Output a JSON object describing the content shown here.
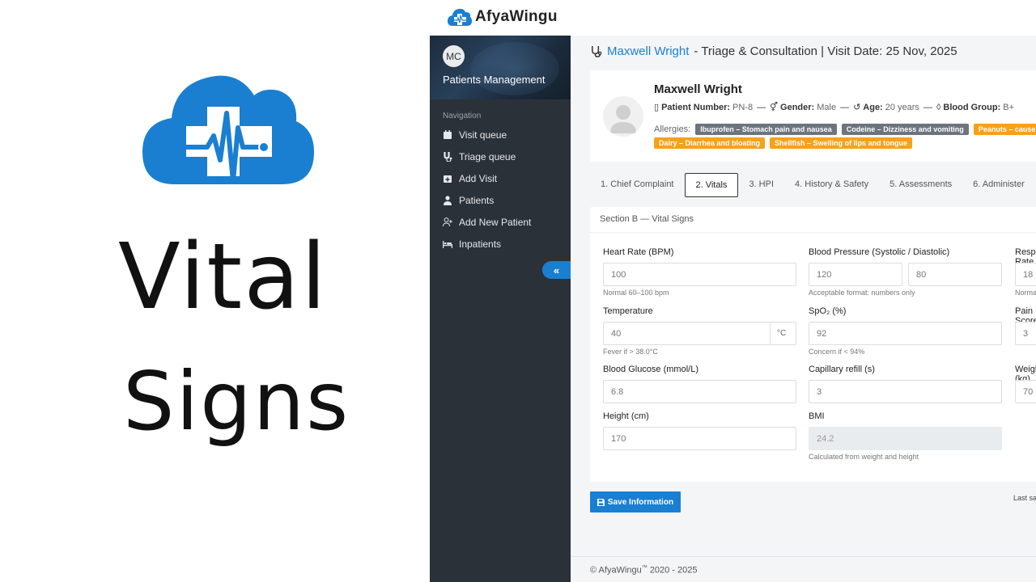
{
  "promo": {
    "title_line1": "Vital",
    "title_line2": "Signs",
    "brand_color": "#1a7fd1"
  },
  "topbar": {
    "brand_name": "AfyaWingu"
  },
  "sidebar": {
    "avatar_initials": "MC",
    "title": "Patients Management",
    "nav_label": "Navigation",
    "items": [
      {
        "label": "Visit queue",
        "icon": "calendar-icon"
      },
      {
        "label": "Triage queue",
        "icon": "stethoscope-icon"
      },
      {
        "label": "Add Visit",
        "icon": "calendar-plus-icon"
      },
      {
        "label": "Patients",
        "icon": "user-doctor-icon"
      },
      {
        "label": "Add New Patient",
        "icon": "user-plus-icon"
      },
      {
        "label": "Inpatients",
        "icon": "bed-icon"
      }
    ],
    "collapse_label": "«"
  },
  "page": {
    "patient_name_link": "Maxwell Wright",
    "heading_rest": "- Triage & Consultation | Visit Date: 25 Nov, 2025"
  },
  "patient": {
    "name": "Maxwell Wright",
    "patient_number_label": "Patient Number:",
    "patient_number": "PN-8",
    "gender_label": "Gender:",
    "gender": "Male",
    "age_label": "Age:",
    "age": "20 years",
    "blood_group_label": "Blood Group:",
    "blood_group": "B+",
    "allergies_label": "Allergies:",
    "allergies": [
      {
        "text": "Ibuprofen – Stomach pain and nausea",
        "color": "gray"
      },
      {
        "text": "Codeine – Dizziness and vomiting",
        "color": "gray"
      },
      {
        "text": "Peanuts – causes throat tightening",
        "color": "orange"
      },
      {
        "text": "Dairy – Diarrhea and bloating",
        "color": "orange"
      },
      {
        "text": "Shellfish – Swelling of lips and tongue",
        "color": "orange"
      }
    ]
  },
  "tabs": [
    {
      "label": "1. Chief Complaint",
      "active": false
    },
    {
      "label": "2. Vitals",
      "active": true
    },
    {
      "label": "3. HPI",
      "active": false
    },
    {
      "label": "4. History & Safety",
      "active": false
    },
    {
      "label": "5. Assessments",
      "active": false
    },
    {
      "label": "6. Administer",
      "active": false
    }
  ],
  "vitals": {
    "section_title": "Section B — Vital Signs",
    "heart_rate": {
      "label": "Heart Rate (BPM)",
      "value": "100",
      "hint": "Normal 60–100 bpm"
    },
    "blood_pressure": {
      "label": "Blood Pressure (Systolic / Diastolic)",
      "systolic": "120",
      "diastolic": "80",
      "hint": "Acceptable format: numbers only"
    },
    "respiratory": {
      "label": "Respiratory Rate",
      "value": "18",
      "hint": "Normal"
    },
    "temperature": {
      "label": "Temperature",
      "value": "40",
      "unit": "°C",
      "hint": "Fever if > 38.0°C"
    },
    "spo2": {
      "label": "SpO₂ (%)",
      "value": "92",
      "hint": "Concern if < 94%"
    },
    "pain": {
      "label": "Pain Score",
      "value": "3"
    },
    "glucose": {
      "label": "Blood Glucose (mmol/L)",
      "value": "6.8"
    },
    "capillary": {
      "label": "Capillary refill (s)",
      "value": "3"
    },
    "weight": {
      "label": "Weight (kg)",
      "value": "70"
    },
    "height": {
      "label": "Height (cm)",
      "value": "170"
    },
    "bmi": {
      "label": "BMI",
      "value": "24.2",
      "hint": "Calculated from weight and height"
    }
  },
  "actions": {
    "save_label": "Save Information",
    "last_saved": "Last saved"
  },
  "footer": {
    "prefix": "© AfyaWingu",
    "tm": "™",
    "years": "2020 - 2025"
  }
}
